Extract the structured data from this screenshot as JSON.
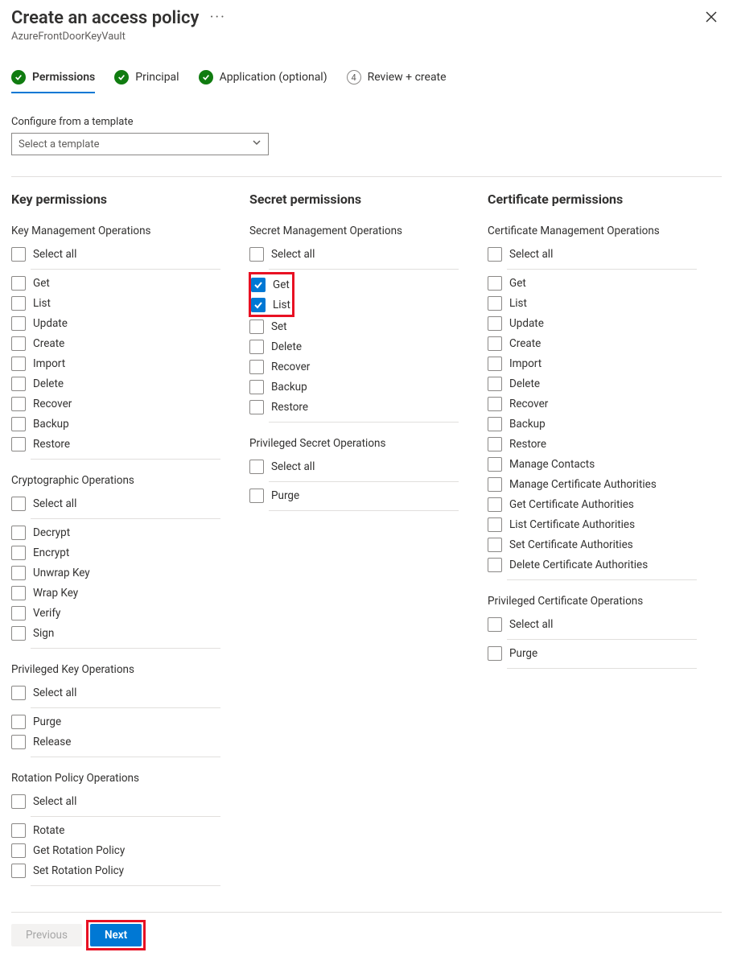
{
  "header": {
    "title": "Create an access policy",
    "subtitle": "AzureFrontDoorKeyVault"
  },
  "tabs": [
    {
      "label": "Permissions",
      "state": "ok",
      "active": true
    },
    {
      "label": "Principal",
      "state": "ok",
      "active": false
    },
    {
      "label": "Application (optional)",
      "state": "ok",
      "active": false
    },
    {
      "label": "Review + create",
      "state": "num",
      "num": "4",
      "active": false
    }
  ],
  "template": {
    "label": "Configure from a template",
    "placeholder": "Select a template"
  },
  "columns": {
    "key": {
      "title": "Key permissions",
      "groups": [
        {
          "title": "Key Management Operations",
          "select_all": "Select all",
          "items": [
            {
              "label": "Get",
              "checked": false
            },
            {
              "label": "List",
              "checked": false
            },
            {
              "label": "Update",
              "checked": false
            },
            {
              "label": "Create",
              "checked": false
            },
            {
              "label": "Import",
              "checked": false
            },
            {
              "label": "Delete",
              "checked": false
            },
            {
              "label": "Recover",
              "checked": false
            },
            {
              "label": "Backup",
              "checked": false
            },
            {
              "label": "Restore",
              "checked": false
            }
          ]
        },
        {
          "title": "Cryptographic Operations",
          "select_all": "Select all",
          "items": [
            {
              "label": "Decrypt",
              "checked": false
            },
            {
              "label": "Encrypt",
              "checked": false
            },
            {
              "label": "Unwrap Key",
              "checked": false
            },
            {
              "label": "Wrap Key",
              "checked": false
            },
            {
              "label": "Verify",
              "checked": false
            },
            {
              "label": "Sign",
              "checked": false
            }
          ]
        },
        {
          "title": "Privileged Key Operations",
          "select_all": "Select all",
          "items": [
            {
              "label": "Purge",
              "checked": false
            },
            {
              "label": "Release",
              "checked": false
            }
          ]
        },
        {
          "title": "Rotation Policy Operations",
          "select_all": "Select all",
          "items": [
            {
              "label": "Rotate",
              "checked": false
            },
            {
              "label": "Get Rotation Policy",
              "checked": false
            },
            {
              "label": "Set Rotation Policy",
              "checked": false
            }
          ]
        }
      ]
    },
    "secret": {
      "title": "Secret permissions",
      "groups": [
        {
          "title": "Secret Management Operations",
          "select_all": "Select all",
          "highlight_first_two": true,
          "items": [
            {
              "label": "Get",
              "checked": true
            },
            {
              "label": "List",
              "checked": true
            },
            {
              "label": "Set",
              "checked": false
            },
            {
              "label": "Delete",
              "checked": false
            },
            {
              "label": "Recover",
              "checked": false
            },
            {
              "label": "Backup",
              "checked": false
            },
            {
              "label": "Restore",
              "checked": false
            }
          ]
        },
        {
          "title": "Privileged Secret Operations",
          "select_all": "Select all",
          "items": [
            {
              "label": "Purge",
              "checked": false
            }
          ]
        }
      ]
    },
    "cert": {
      "title": "Certificate permissions",
      "groups": [
        {
          "title": "Certificate Management Operations",
          "select_all": "Select all",
          "items": [
            {
              "label": "Get",
              "checked": false
            },
            {
              "label": "List",
              "checked": false
            },
            {
              "label": "Update",
              "checked": false
            },
            {
              "label": "Create",
              "checked": false
            },
            {
              "label": "Import",
              "checked": false
            },
            {
              "label": "Delete",
              "checked": false
            },
            {
              "label": "Recover",
              "checked": false
            },
            {
              "label": "Backup",
              "checked": false
            },
            {
              "label": "Restore",
              "checked": false
            },
            {
              "label": "Manage Contacts",
              "checked": false
            },
            {
              "label": "Manage Certificate Authorities",
              "checked": false
            },
            {
              "label": "Get Certificate Authorities",
              "checked": false
            },
            {
              "label": "List Certificate Authorities",
              "checked": false
            },
            {
              "label": "Set Certificate Authorities",
              "checked": false
            },
            {
              "label": "Delete Certificate Authorities",
              "checked": false
            }
          ]
        },
        {
          "title": "Privileged Certificate Operations",
          "select_all": "Select all",
          "items": [
            {
              "label": "Purge",
              "checked": false
            }
          ]
        }
      ]
    }
  },
  "footer": {
    "previous": "Previous",
    "next": "Next",
    "highlight_next": true
  }
}
